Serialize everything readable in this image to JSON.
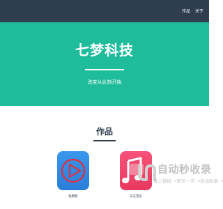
{
  "nav": {
    "items": [
      "作品",
      "关于"
    ]
  },
  "hero": {
    "title": "七梦科技",
    "subtitle": "改变从此刻开始"
  },
  "works": {
    "title": "作品",
    "apps": [
      {
        "label": "免费影",
        "icon": "video-play-icon",
        "color": "#2f8ae3"
      },
      {
        "label": "天天音乐",
        "icon": "music-note-icon",
        "color": "#f0476b"
      }
    ]
  },
  "watermark": {
    "main": "自动秒收录",
    "sub": "做上链接 →来访一次 →自动收录 →"
  },
  "colors": {
    "topbar": "#2e3e4f",
    "hero": "#1fbc9c",
    "accent_blue": "#2f8ae3",
    "accent_pink": "#f0476b"
  }
}
